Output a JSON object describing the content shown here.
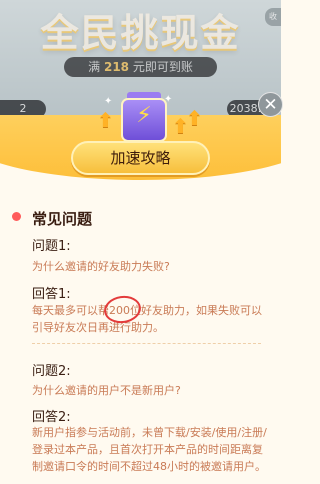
{
  "background": {
    "title": "全民挑现金",
    "badge_prefix": "满",
    "badge_amount": "218",
    "badge_suffix": "元即可到账",
    "corner_text": "收",
    "digits_left": "2",
    "digits_right": "2038:1"
  },
  "close_button": {
    "icon": "close-icon",
    "symbol": "✕"
  },
  "speed_button": {
    "label": "加速攻略"
  },
  "faq": {
    "title": "常见问题",
    "items": [
      {
        "question_label": "问题1:",
        "question": "为什么邀请的好友助力失败?",
        "answer_label": "回答1:",
        "answer": "每天最多可以帮200位好友助力，如果失败可以引导好友次日再进行助力。"
      },
      {
        "question_label": "问题2:",
        "question": "为什么邀请的用户不是新用户?",
        "answer_label": "回答2:",
        "answer": "新用户指参与活动前，未曾下载/安装/使用/注册/登录过本产品，且首次打开本产品的时间距离复制邀请口令的时间不超过48小时的被邀请用户。"
      }
    ]
  },
  "colors": {
    "accent": "#fdbf3a",
    "text_dark": "#3a1e12",
    "text_orange": "#c97b56",
    "annotation_red": "#e33b3b"
  }
}
